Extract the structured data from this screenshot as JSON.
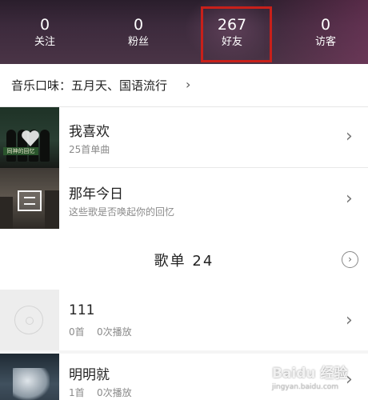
{
  "stats": [
    {
      "value": "0",
      "label": "关注"
    },
    {
      "value": "0",
      "label": "粉丝"
    },
    {
      "value": "267",
      "label": "好友"
    },
    {
      "value": "0",
      "label": "访客"
    }
  ],
  "highlight_color": "#c8201a",
  "music_taste": {
    "text": "音乐口味：五月天、国语流行",
    "chevron": "›"
  },
  "liked": {
    "title": "我喜欢",
    "subtitle": "25首单曲",
    "cover_text": "同神的回忆"
  },
  "on_this_day": {
    "title": "那年今日",
    "subtitle": "这些歌是否唤起你的回忆"
  },
  "playlists_header": {
    "title": "歌单 24",
    "icon": "chevron-right-circle-icon"
  },
  "playlists": [
    {
      "title": "111",
      "count": "0首",
      "plays": "0次播放"
    },
    {
      "title": "明明就",
      "count": "1首",
      "plays": "0次播放"
    }
  ],
  "watermark": {
    "logo": "Baidu 经验",
    "site": "jingyan.baidu.com"
  },
  "arrow": "›"
}
